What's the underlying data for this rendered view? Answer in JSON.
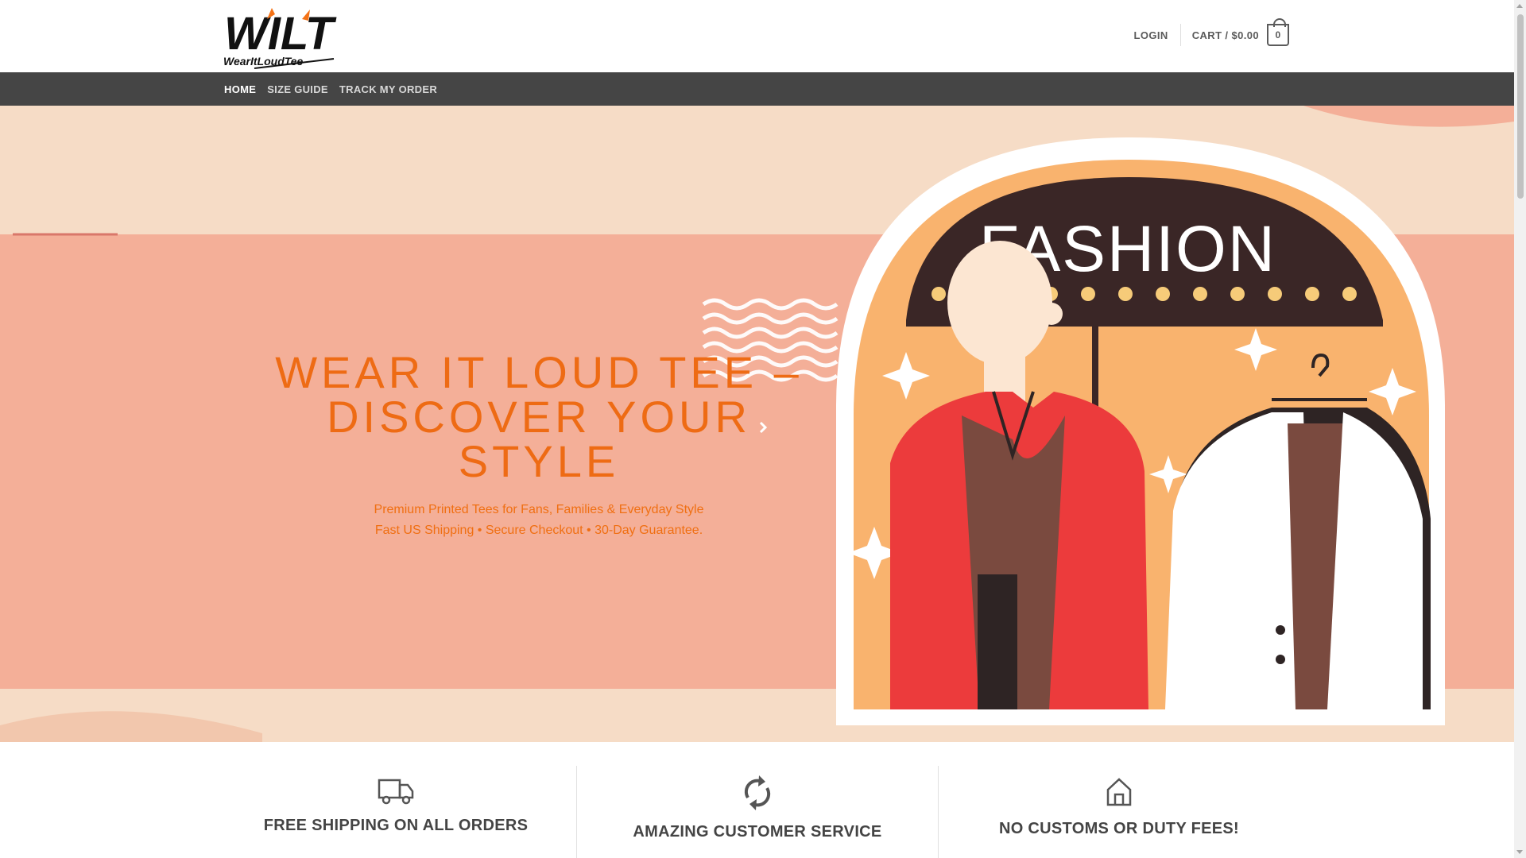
{
  "header": {
    "logo_text": "WILT",
    "logo_tagline": "WearItLoudTee",
    "login_label": "LOGIN",
    "cart_label": "CART / $0.00",
    "cart_count": "0"
  },
  "nav": {
    "items": [
      {
        "label": "HOME"
      },
      {
        "label": "SIZE GUIDE"
      },
      {
        "label": "TRACK MY ORDER"
      }
    ]
  },
  "hero": {
    "title_line1": "WEAR IT LOUD TEE –",
    "title_line2": "DISCOVER YOUR STYLE",
    "subtitle_line1": "Premium Printed Tees for Fans, Families & Everyday Style",
    "subtitle_line2": "Fast US Shipping • Secure Checkout • 30-Day Guarantee.",
    "sign_text": "FASHION"
  },
  "features": [
    {
      "title": "FREE SHIPPING ON ALL ORDERS",
      "icon": "truck-icon"
    },
    {
      "title": "AMAZING CUSTOMER SERVICE",
      "icon": "refresh-icon"
    },
    {
      "title": "NO CUSTOMS OR DUTY FEES!",
      "icon": "home-icon"
    }
  ],
  "colors": {
    "accent_orange": "#ee6b14",
    "nav_bg": "#454545",
    "hero_peach": "#f6dcc6",
    "hero_salmon": "#f4af98"
  }
}
